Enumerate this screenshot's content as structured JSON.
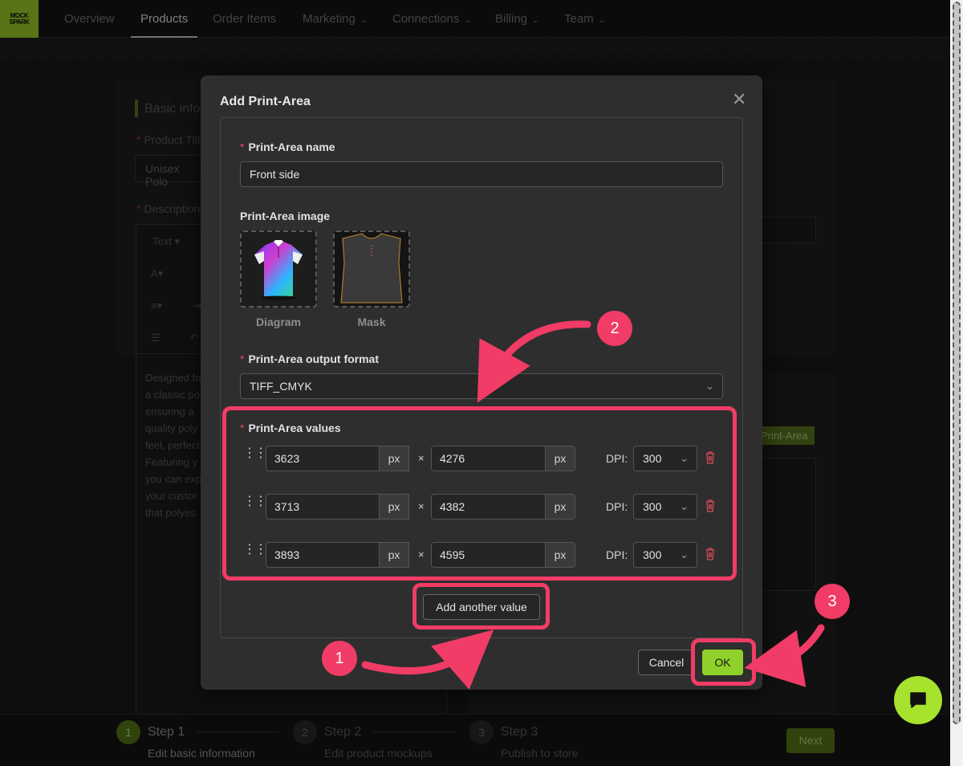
{
  "nav": {
    "logo_top": "MOCK",
    "logo_bottom": "SPARK",
    "items": [
      {
        "label": "Overview"
      },
      {
        "label": "Products"
      },
      {
        "label": "Order Items"
      },
      {
        "label": "Marketing"
      },
      {
        "label": "Connections"
      },
      {
        "label": "Billing"
      },
      {
        "label": "Team"
      }
    ],
    "active": "Products"
  },
  "background": {
    "section_title": "Basic infor",
    "product_title_label": "Product Titl",
    "product_title_value": "Unisex Polo",
    "description_label": "Description",
    "editor_text_menu": "Text",
    "editor_body": [
      "Designed fo",
      "a classic po",
      "ensuring a",
      "quality poly",
      "feel, perfect",
      "Featuring y",
      "you can exp",
      "your custor",
      "that polyes"
    ],
    "print_area_badge": "Print-Area"
  },
  "modal": {
    "title": "Add Print-Area",
    "name_label": "Print-Area name",
    "name_value": "Front side",
    "image_label": "Print-Area image",
    "diagram_caption": "Diagram",
    "mask_caption": "Mask",
    "format_label": "Print-Area output format",
    "format_value": "TIFF_CMYK",
    "values_label": "Print-Area values",
    "unit": "px",
    "times": "×",
    "dpi_label": "DPI:",
    "values": [
      {
        "width": "3623",
        "height": "4276",
        "dpi": "300"
      },
      {
        "width": "3713",
        "height": "4382",
        "dpi": "300"
      },
      {
        "width": "3893",
        "height": "4595",
        "dpi": "300"
      }
    ],
    "add_value_label": "Add another value",
    "cancel_label": "Cancel",
    "ok_label": "OK"
  },
  "annotations": {
    "step1": "1",
    "step2": "2",
    "step3": "3",
    "highlight_color": "#f03c66"
  },
  "steps": [
    {
      "num": "1",
      "title": "Step 1",
      "subtitle": "Edit basic information"
    },
    {
      "num": "2",
      "title": "Step 2",
      "subtitle": "Edit product mockups"
    },
    {
      "num": "3",
      "title": "Step 3",
      "subtitle": "Publish to store"
    }
  ],
  "next_label": "Next",
  "colors": {
    "accent": "#8fd12a",
    "annotation": "#f03c66"
  }
}
